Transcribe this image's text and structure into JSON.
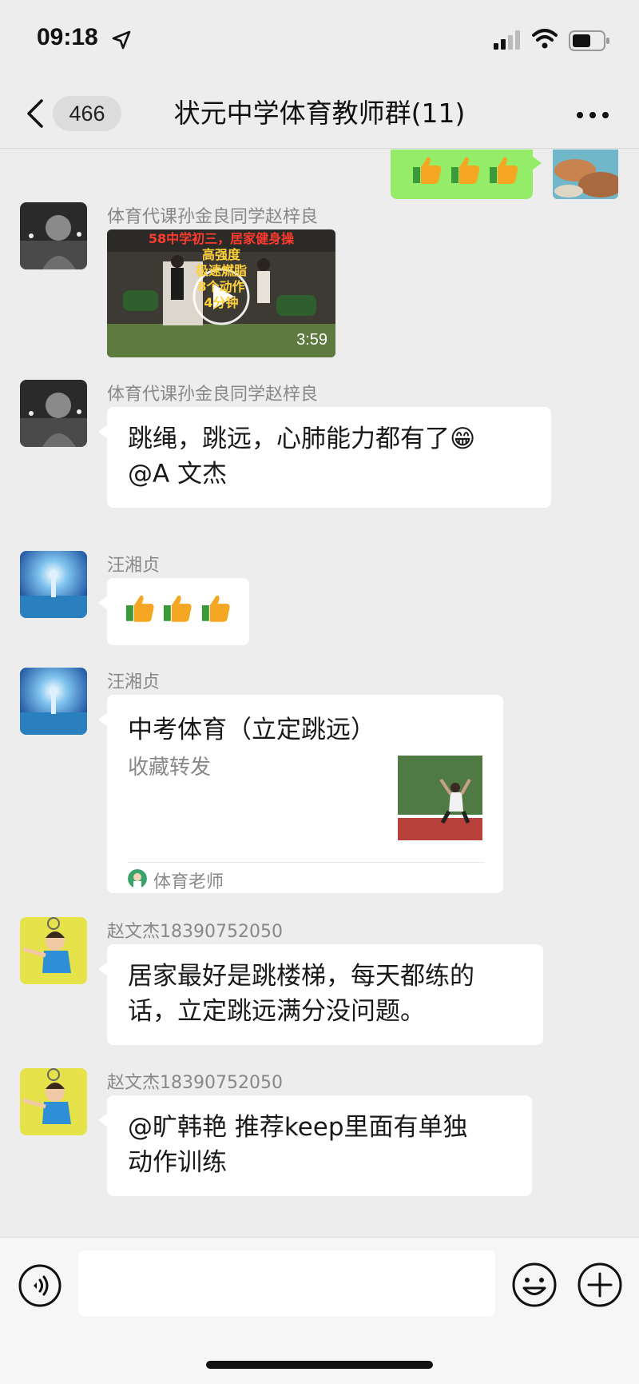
{
  "status_bar": {
    "time": "09:18",
    "icons": [
      "location-arrow-icon",
      "cellular-signal-icon",
      "wifi-icon",
      "battery-icon"
    ]
  },
  "nav": {
    "unread_count": "466",
    "title": "状元中学体育教师群(11)",
    "icons": [
      "back-chevron-icon",
      "more-dots-icon"
    ]
  },
  "messages": [
    {
      "type": "self",
      "content": "👍👍👍"
    },
    {
      "type": "video",
      "sender": "体育代课孙金良同学赵梓良",
      "duration": "3:59",
      "thumb_lines": [
        "58中学初三，居家健身操",
        "高强度",
        "极速燃脂",
        "8个动作",
        "4分钟"
      ]
    },
    {
      "type": "text",
      "sender": "体育代课孙金良同学赵梓良",
      "lines": [
        "跳绳，跳远，心肺能力都有了😁",
        "@A 文杰"
      ]
    },
    {
      "type": "text",
      "sender": "汪湘贞",
      "content": "👍👍👍"
    },
    {
      "type": "share",
      "sender": "汪湘贞",
      "title": "中考体育（立定跳远）",
      "desc": "收藏转发",
      "source": "体育老师"
    },
    {
      "type": "text",
      "sender": "赵文杰18390752050",
      "lines": [
        "居家最好是跳楼梯，每天都练的",
        "话，立定跳远满分没问题。"
      ]
    },
    {
      "type": "text",
      "sender": "赵文杰18390752050",
      "lines": [
        "@旷韩艳 推荐keep里面有单独",
        "动作训练"
      ]
    }
  ],
  "input_bar": {
    "message_value": "",
    "icons": [
      "voice-icon",
      "emoji-icon",
      "plus-icon"
    ]
  },
  "colors": {
    "background": "#ededed",
    "self_bubble": "#95ec69",
    "other_bubble": "#ffffff",
    "sender_name": "#888888"
  }
}
